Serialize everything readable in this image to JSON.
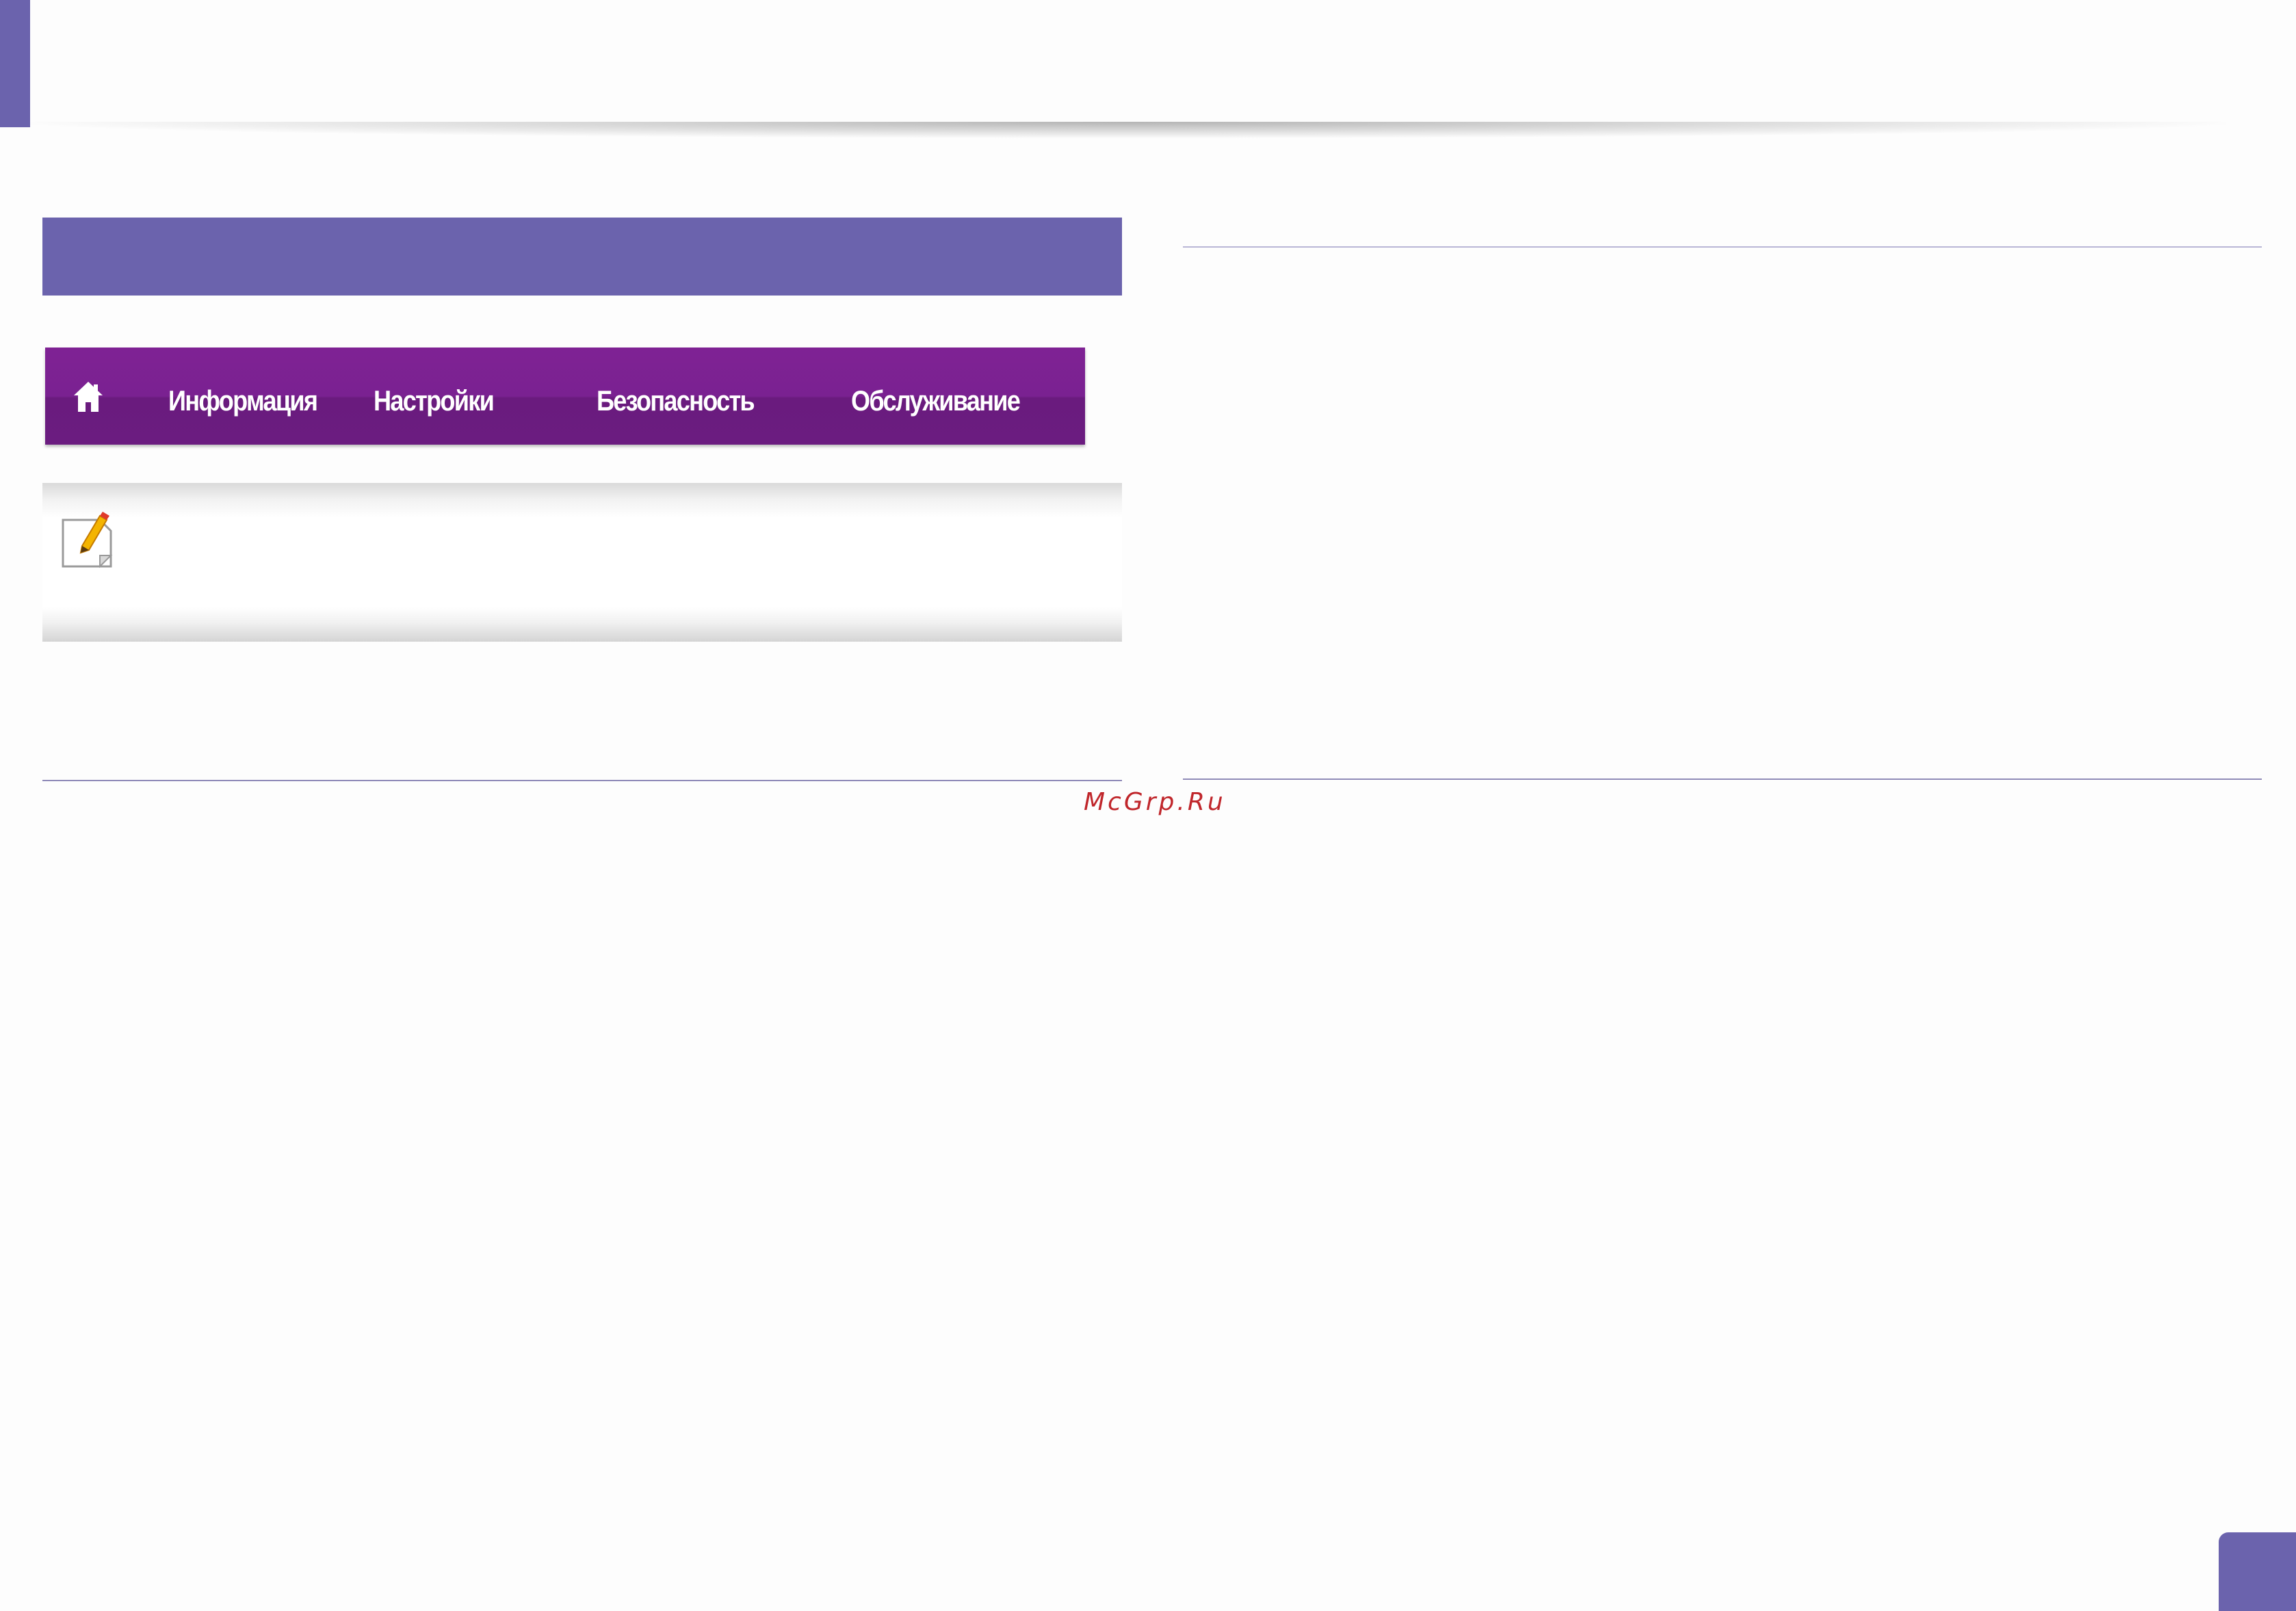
{
  "colors": {
    "accent": "#6b63ad",
    "nav_purple": "#7a2191",
    "watermark_red": "#c0262b"
  },
  "nav": {
    "home_icon": "home-icon",
    "items": [
      {
        "label": "Информация"
      },
      {
        "label": "Настройки"
      },
      {
        "label": "Безопасность"
      },
      {
        "label": "Обслуживание"
      }
    ]
  },
  "note": {
    "icon": "note-pencil-icon"
  },
  "watermark": {
    "text": "McGrp.Ru"
  }
}
